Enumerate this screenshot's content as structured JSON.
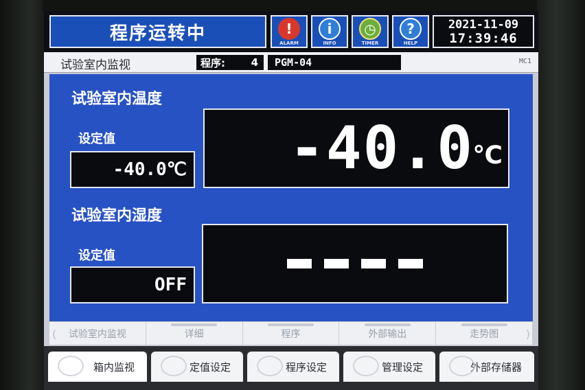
{
  "header": {
    "title": "程序运转中",
    "buttons": [
      {
        "name": "alarm",
        "label": "ALARM",
        "glyph": "!",
        "color": "#d8382c"
      },
      {
        "name": "info",
        "label": "INFO",
        "glyph": "i",
        "color": "#2f7fd8"
      },
      {
        "name": "timer",
        "label": "TIMER",
        "glyph": "◷",
        "color": "#6cae3a"
      },
      {
        "name": "help",
        "label": "HELP",
        "glyph": "?",
        "color": "#2f7fd8"
      }
    ],
    "date": "2021-11-09",
    "time": "17:39:46"
  },
  "infobar": {
    "room_title": "试验室内监视",
    "program_label": "程序:",
    "program_number": "4",
    "program_name": "PGM-04",
    "code": "MC1"
  },
  "temperature": {
    "section_title": "试验室内温度",
    "setpoint_label": "设定值",
    "setpoint_value": "-40.0℃",
    "current_value": "-40.0",
    "unit": "℃"
  },
  "humidity": {
    "section_title": "试验室内湿度",
    "setpoint_label": "设定值",
    "setpoint_value": "OFF"
  },
  "subtabs": [
    {
      "label": "试验室内监视"
    },
    {
      "label": "详细"
    },
    {
      "label": "程序"
    },
    {
      "label": "外部输出"
    },
    {
      "label": "走势图"
    }
  ],
  "bottom_tabs": [
    {
      "label": "箱内监视"
    },
    {
      "label": "定值设定"
    },
    {
      "label": "程序设定"
    },
    {
      "label": "管理设定"
    },
    {
      "label": "外部存储器"
    }
  ]
}
